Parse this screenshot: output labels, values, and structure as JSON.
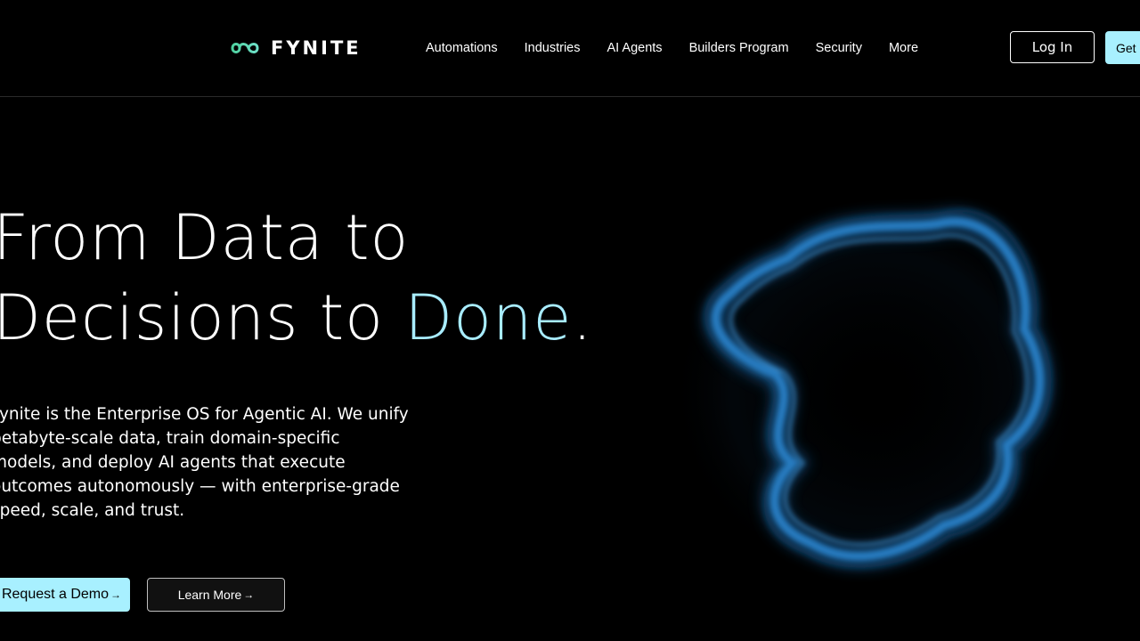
{
  "brand": {
    "name": "FYNITE",
    "logo_icon": "infinity-icon",
    "accent_color": "#a8f0ff"
  },
  "nav": {
    "items": [
      {
        "label": "Automations"
      },
      {
        "label": "Industries"
      },
      {
        "label": "AI Agents"
      },
      {
        "label": "Builders Program"
      },
      {
        "label": "Security"
      },
      {
        "label": "More"
      }
    ]
  },
  "header": {
    "login_label": "Log In",
    "get_label": "Get"
  },
  "hero": {
    "title_line1": "From Data to",
    "title_line2_prefix": "Decisions to ",
    "title_line2_accent": "Done",
    "title_line2_suffix": ".",
    "description": "Fynite is the Enterprise OS for Agentic AI. We unify petabyte-scale data, train domain-specific models, and deploy AI agents that execute outcomes autonomously — with enterprise-grade speed, scale, and trust.",
    "primary_cta": "Request a Demo",
    "secondary_cta": "Learn More",
    "cta_arrow": "→"
  }
}
